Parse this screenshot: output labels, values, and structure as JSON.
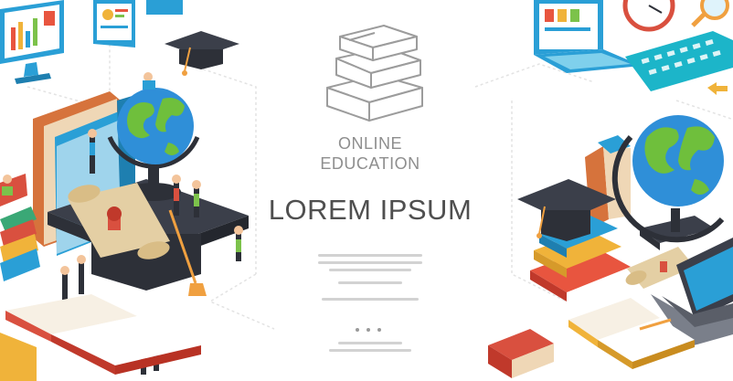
{
  "poster": {
    "subtitle_line1": "ONLINE",
    "subtitle_line2": "EDUCATION",
    "title": "LOREM IPSUM"
  },
  "icons": {
    "center": "stacked-books-outline-icon",
    "left": [
      "monitor-chart-icon",
      "tablet-chart-icon",
      "graduation-cap-icon",
      "globe-icon",
      "books-stack-icon",
      "diploma-scroll-icon",
      "open-book-icon",
      "students-people-icon"
    ],
    "right": [
      "laptop-icon",
      "clock-icon",
      "magnifier-icon",
      "keyboard-icon",
      "globe-icon",
      "graduation-cap-icon",
      "books-stack-icon",
      "diploma-scroll-icon",
      "open-book-icon",
      "red-book-icon"
    ]
  },
  "colors": {
    "background": "#ffffff",
    "title_text": "#4f4f4f",
    "subtitle_text": "#8e8e8e",
    "globe_ocean": "#2f8fd8",
    "globe_land": "#6fbf3c",
    "cap": "#3b3f4a",
    "accent_teal": "#1cb5c9",
    "accent_orange": "#f0a040",
    "accent_red": "#d9503f"
  }
}
